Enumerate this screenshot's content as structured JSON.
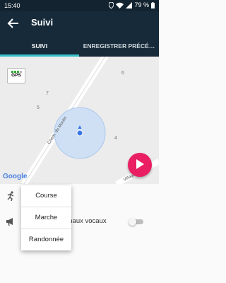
{
  "status_bar": {
    "time": "15:40",
    "battery": "79 %",
    "icons": [
      "location-icon",
      "wifi-icon",
      "signal-icon",
      "battery-icon"
    ]
  },
  "app_bar": {
    "title": "Suivi",
    "back_icon": "back-arrow-icon"
  },
  "tabs": [
    {
      "label": "SUIVI",
      "selected": true
    },
    {
      "label": "ENREGISTRER PRÉCÉ…",
      "selected": false
    }
  ],
  "map": {
    "gps_label": "GPS",
    "street_label": "Chem. du Moulin",
    "street_label_2": "Village",
    "house_numbers": [
      "6",
      "7",
      "5",
      "4"
    ],
    "attribution": "Google",
    "colors": {
      "accuracy_circle": "#cfe0f5",
      "location_dot": "#3b78e7"
    }
  },
  "fab": {
    "icon": "play-icon",
    "color": "#e91e63"
  },
  "settings": [
    {
      "icon": "runner-icon",
      "label": ""
    },
    {
      "icon": "megaphone-icon",
      "label": "gnaux vocaux",
      "toggle_on": false
    }
  ],
  "activity_menu": {
    "items": [
      "Course",
      "Marche",
      "Randonnée"
    ]
  }
}
